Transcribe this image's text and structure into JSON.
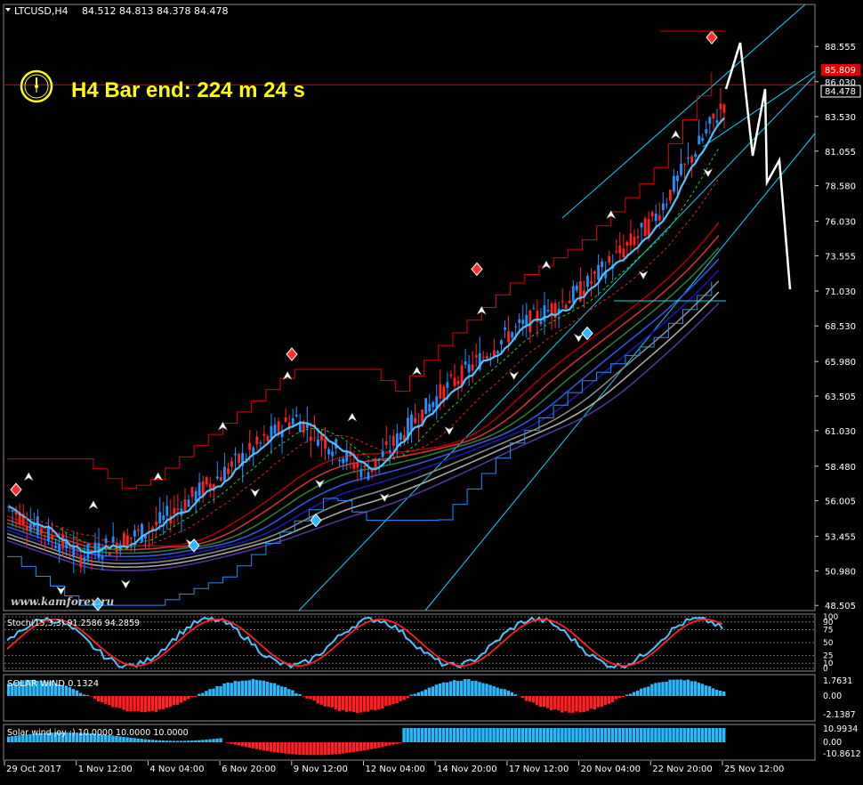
{
  "header": {
    "symbol_tf": "LTCUSD,H4",
    "ohlc": "84.512 84.813 84.378 84.478"
  },
  "timer": {
    "text": "H4 Bar end: 224 m 24 s"
  },
  "watermark": "www.kamforex.ru",
  "price_axis": {
    "ticks": [
      "88.555",
      "86.030",
      "83.530",
      "81.055",
      "78.580",
      "76.030",
      "73.555",
      "71.030",
      "68.530",
      "65.980",
      "63.505",
      "61.030",
      "58.480",
      "56.005",
      "53.455",
      "50.980",
      "48.505"
    ],
    "red_level": "85.809",
    "current_price": "84.478",
    "ylim": [
      48.2,
      91.5
    ]
  },
  "time_axis": [
    "29 Oct 2017",
    "1 Nov 12:00",
    "4 Nov 04:00",
    "6 Nov 20:00",
    "9 Nov 12:00",
    "12 Nov 04:00",
    "14 Nov 20:00",
    "17 Nov 12:00",
    "20 Nov 04:00",
    "22 Nov 20:00",
    "25 Nov 12:00"
  ],
  "stoch": {
    "label": "Stoch(15,3,3) 91.2586 94.2859",
    "levels": [
      "100",
      "90",
      "75",
      "50",
      "25",
      "10",
      "0"
    ]
  },
  "solar": {
    "label": "SOLAR WIND 0.1324",
    "ticks": [
      "1.7631",
      "0.00",
      "-2.1387"
    ]
  },
  "joy": {
    "label": "Solar wind joy :) 10.0000 10.0000 10.0000",
    "ticks": [
      "10.9934",
      "0.00",
      "-10.8612"
    ]
  },
  "colors": {
    "bull": "#1e90ff",
    "bear": "#ff2020",
    "channel": "#00d7ff",
    "stop_red": "#e00000",
    "stop_blue": "#1e90ff",
    "zigzag": "#ffffff",
    "timer": "#ffff00"
  },
  "chart_data": {
    "type": "line",
    "title": "LTCUSD,H4",
    "x": [
      "29 Oct 2017",
      "1 Nov 12:00",
      "4 Nov 04:00",
      "6 Nov 20:00",
      "9 Nov 12:00",
      "12 Nov 04:00",
      "14 Nov 20:00",
      "17 Nov 12:00",
      "20 Nov 04:00",
      "22 Nov 20:00",
      "25 Nov 12:00"
    ],
    "series": [
      {
        "values": [
          55.5,
          52.0,
          54.0,
          58.0,
          62.0,
          58.0,
          63.5,
          68.0,
          71.0,
          76.0,
          84.5
        ]
      }
    ],
    "ylim": [
      48.2,
      91.5
    ]
  }
}
